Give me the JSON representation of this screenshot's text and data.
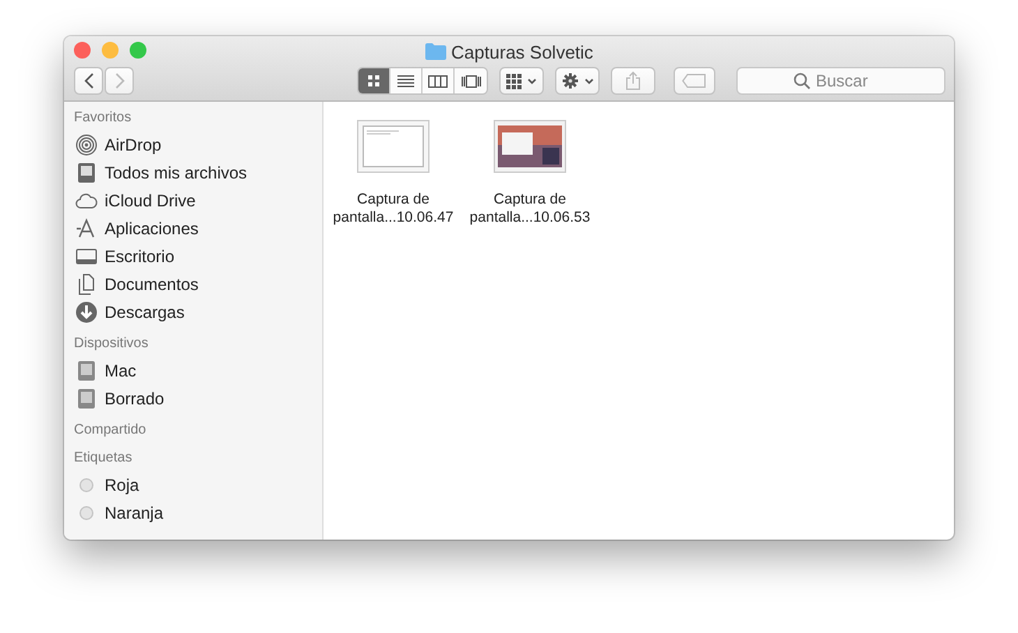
{
  "window": {
    "title": "Capturas Solvetic"
  },
  "toolbar": {
    "view_modes": [
      {
        "kind": "icons",
        "selected": true
      },
      {
        "kind": "list",
        "selected": false
      },
      {
        "kind": "columns",
        "selected": false
      },
      {
        "kind": "coverflow",
        "selected": false
      }
    ],
    "back_disabled": false,
    "forward_disabled": true,
    "share_disabled": true,
    "tags_disabled": true,
    "search": {
      "placeholder": "Buscar"
    }
  },
  "sidebar": {
    "sections": [
      {
        "title": "Favoritos",
        "items": [
          {
            "label": "AirDrop",
            "kind": "airdrop"
          },
          {
            "label": "Todos mis archivos",
            "kind": "allfiles"
          },
          {
            "label": "iCloud Drive",
            "kind": "cloud"
          },
          {
            "label": "Aplicaciones",
            "kind": "apps"
          },
          {
            "label": "Escritorio",
            "kind": "desktop"
          },
          {
            "label": "Documentos",
            "kind": "documents"
          },
          {
            "label": "Descargas",
            "kind": "downloads"
          }
        ]
      },
      {
        "title": "Dispositivos",
        "items": [
          {
            "label": "Mac",
            "kind": "disk"
          },
          {
            "label": "Borrado",
            "kind": "disk"
          }
        ]
      },
      {
        "title": "Compartido"
      },
      {
        "title": "Etiquetas",
        "items": [
          {
            "label": "Roja",
            "kind": "tag"
          },
          {
            "label": "Naranja",
            "kind": "tag"
          }
        ]
      }
    ]
  },
  "files": [
    {
      "name_lines": [
        "Captura de",
        "pantalla...10.06.47"
      ],
      "kind": "blank-screenshot"
    },
    {
      "name_lines": [
        "Captura de",
        "pantalla...10.06.53"
      ],
      "kind": "desktop-screenshot"
    }
  ]
}
